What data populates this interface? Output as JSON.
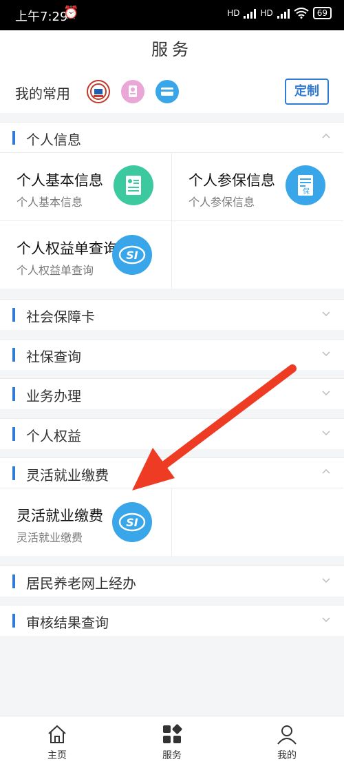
{
  "status": {
    "time": "上午7:29",
    "battery": "69",
    "hd1": "HD",
    "hd2": "HD"
  },
  "header": {
    "title": "服务"
  },
  "favorites": {
    "label": "我的常用",
    "custom_button": "定制",
    "icons": [
      "social-security-logo-icon",
      "id-card-icon",
      "bank-card-icon"
    ]
  },
  "sections": {
    "personal_info": {
      "title": "个人信息",
      "items": [
        {
          "title": "个人基本信息",
          "subtitle": "个人基本信息",
          "icon": "profile-document-icon"
        },
        {
          "title": "个人参保信息",
          "subtitle": "个人参保信息",
          "icon": "insurance-document-icon"
        },
        {
          "title": "个人权益单查询",
          "subtitle": "个人权益单查询",
          "icon": "si-logo-icon"
        }
      ]
    },
    "social_card": {
      "title": "社会保障卡"
    },
    "social_query": {
      "title": "社保查询"
    },
    "business": {
      "title": "业务办理"
    },
    "rights": {
      "title": "个人权益"
    },
    "flexible": {
      "title": "灵活就业缴费",
      "items": [
        {
          "title": "灵活就业缴费",
          "subtitle": "灵活就业缴费",
          "icon": "si-logo-icon"
        }
      ]
    },
    "pension": {
      "title": "居民养老网上经办"
    },
    "review": {
      "title": "审核结果查询"
    }
  },
  "tabbar": {
    "tabs": [
      {
        "label": "主页",
        "icon": "home-icon"
      },
      {
        "label": "服务",
        "icon": "grid-icon"
      },
      {
        "label": "我的",
        "icon": "user-icon"
      }
    ]
  },
  "colors": {
    "accent": "#2f7bd6",
    "arrow": "#ee3b24",
    "green": "#3cc9a0",
    "blue": "#3aa6ea"
  }
}
